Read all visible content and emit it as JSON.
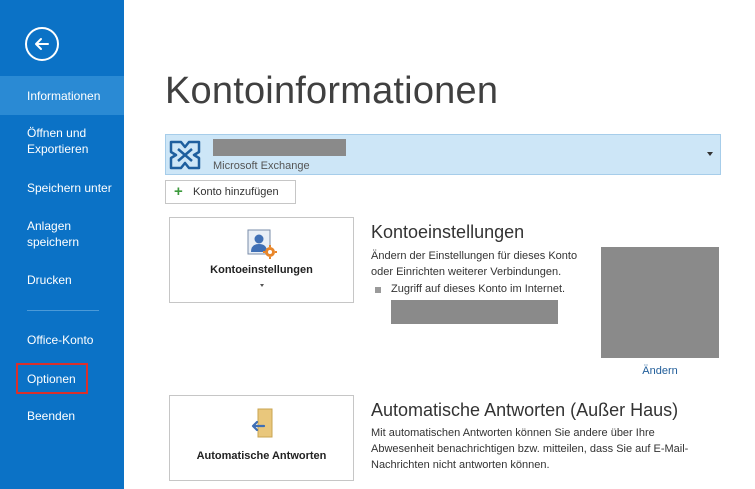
{
  "sidebar": {
    "items": [
      {
        "label": "Informationen"
      },
      {
        "label": "Öffnen und Exportieren"
      },
      {
        "label": "Speichern unter"
      },
      {
        "label": "Anlagen speichern"
      },
      {
        "label": "Drucken"
      },
      {
        "label": "Office-Konto"
      },
      {
        "label": "Optionen"
      },
      {
        "label": "Beenden"
      }
    ]
  },
  "main": {
    "title": "Kontoinformationen",
    "account": {
      "type": "Microsoft Exchange"
    },
    "add_account_label": "Konto hinzufügen",
    "account_settings": {
      "tile_label": "Kontoeinstellungen",
      "title": "Kontoeinstellungen",
      "desc_line1": "Ändern der Einstellungen für dieses Konto",
      "desc_line2": "oder Einrichten weiterer Verbindungen.",
      "bullet": "Zugriff auf dieses Konto im Internet.",
      "change_label": "Ändern"
    },
    "auto_reply": {
      "tile_label": "Automatische Antworten",
      "title": "Automatische Antworten (Außer Haus)",
      "desc_line1": "Mit automatischen Antworten können Sie andere über Ihre",
      "desc_line2": "Abwesenheit benachrichtigen bzw. mitteilen, dass Sie auf E-Mail-",
      "desc_line3": "Nachrichten nicht antworten können."
    }
  },
  "colors": {
    "sidebar": "#0b72c6",
    "active_item": "#2a8ad4",
    "highlight": "#d9302c",
    "account_bg": "#cde6f7"
  }
}
